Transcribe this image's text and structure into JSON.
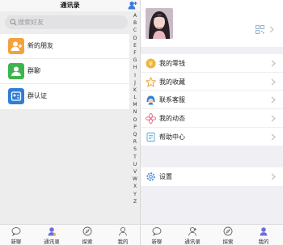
{
  "contacts": {
    "title": "通讯录",
    "search_placeholder": "搜索好友",
    "items": [
      {
        "label": "新的朋友",
        "color": "#f3a23e"
      },
      {
        "label": "群聊",
        "color": "#3eb54c"
      },
      {
        "label": "群认证",
        "color": "#2f7fd8"
      }
    ],
    "index": [
      "A",
      "B",
      "C",
      "D",
      "E",
      "F",
      "G",
      "H",
      "I",
      "J",
      "K",
      "L",
      "M",
      "N",
      "O",
      "P",
      "Q",
      "R",
      "S",
      "T",
      "U",
      "V",
      "W",
      "X",
      "Y",
      "Z"
    ]
  },
  "me": {
    "menu_group1": [
      {
        "label": "我的零钱",
        "icon": "coin-icon"
      },
      {
        "label": "我的收藏",
        "icon": "star-icon"
      },
      {
        "label": "联系客服",
        "icon": "service-icon"
      },
      {
        "label": "我的动态",
        "icon": "flower-icon"
      },
      {
        "label": "帮助中心",
        "icon": "help-icon"
      }
    ],
    "menu_group2": [
      {
        "label": "设置",
        "icon": "gear-icon"
      }
    ]
  },
  "tabbar_left": [
    "新聊",
    "通讯录",
    "探索",
    "我的"
  ],
  "tabbar_right": [
    "新聊",
    "通讯录",
    "探索",
    "我的"
  ],
  "colors": {
    "accent": "#6e6ed8",
    "inactive": "#777777"
  }
}
